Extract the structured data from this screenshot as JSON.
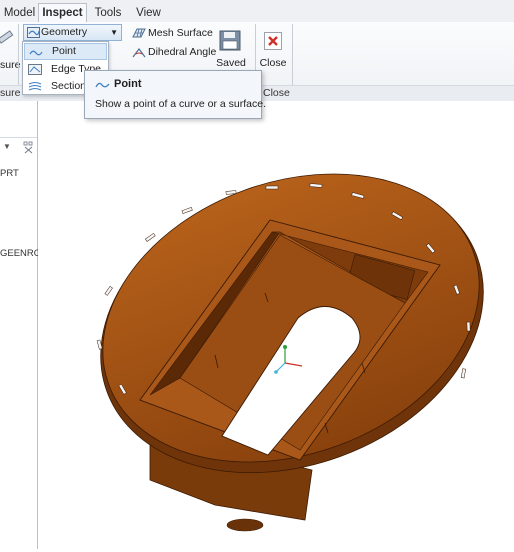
{
  "tabs": [
    "Model",
    "Inspect",
    "Tools",
    "View"
  ],
  "active_tab": "Inspect",
  "ribbon": {
    "geometry_report_label": "Geometry Report",
    "mesh_surface_label": "Mesh Surface",
    "dihedral_angle_label": "Dihedral Angle",
    "saved_label": "Saved",
    "close_label": "Close",
    "measure_partial": "sure",
    "group_measure_partial": "sure",
    "group_close": "Close"
  },
  "menu": {
    "items": [
      "Point",
      "Edge Type",
      "Sections"
    ]
  },
  "tooltip": {
    "title": "Point",
    "description": "Show a point of a curve or a surface."
  },
  "left_panel": {
    "line1": "PRT",
    "line2": "GEENROU"
  },
  "colors": {
    "model_body": "#9c4e12",
    "model_dark": "#5e2a06",
    "close_red": "#d0302a",
    "accent_blue": "#3f7fc6"
  }
}
